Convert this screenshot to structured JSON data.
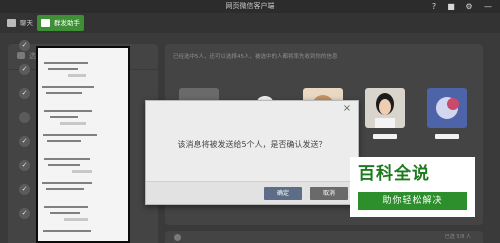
{
  "window": {
    "title": "网页微信客户端"
  },
  "titlebar_buttons": [
    {
      "label": "?",
      "icon": "help-icon"
    },
    {
      "label": "■",
      "icon": "chat-bubble-icon"
    },
    {
      "label": "⚙",
      "icon": "gear-icon"
    },
    {
      "label": "—",
      "icon": "minimize-icon"
    }
  ],
  "nav": {
    "chat_label": "聊天",
    "broadcast_label": "群发助手"
  },
  "left_panel": {
    "header": "选择收信人",
    "checked_items": 8
  },
  "right_panel": {
    "header": "已经选中5人，还可以选择45人，被选中的人都将率先收到你的信息",
    "selected_count_text": "已选 5/8 人"
  },
  "dialog": {
    "message": "该消息将被发送给5个人，是否确认发送？",
    "ok_label": "确定",
    "cancel_label": "取消",
    "close_glyph": "×"
  },
  "watermark": {
    "logo": "百科全说",
    "subtitle": "助你轻松解决"
  },
  "colors": {
    "accent": "#3f8f37",
    "background": "#3a3a3a",
    "dialog": "#ececec"
  }
}
